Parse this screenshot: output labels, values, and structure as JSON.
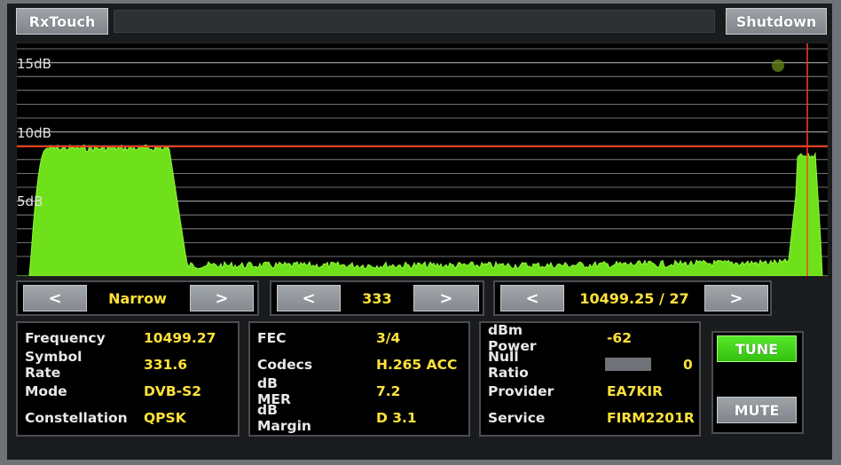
{
  "topbar": {
    "app_button": "RxTouch",
    "shutdown_button": "Shutdown"
  },
  "spectrum": {
    "y_labels": [
      "15dB",
      "10dB",
      "5dB"
    ],
    "colors": {
      "trace": "#6fe11b",
      "threshold": "#ff3b1e",
      "grid": "#c8c8c8"
    }
  },
  "controls": {
    "bandwidth": {
      "prev": "<",
      "value": "Narrow",
      "next": ">"
    },
    "symbol_rate": {
      "prev": "<",
      "value": "333",
      "next": ">"
    },
    "frequency": {
      "prev": "<",
      "value": "10499.25 / 27",
      "next": ">"
    }
  },
  "info": {
    "left": [
      {
        "label": "Frequency",
        "value": "10499.27"
      },
      {
        "label": "Symbol Rate",
        "value": "331.6"
      },
      {
        "label": "Mode",
        "value": "DVB-S2"
      },
      {
        "label": "Constellation",
        "value": "QPSK"
      }
    ],
    "middle": [
      {
        "label": "FEC",
        "value": "3/4"
      },
      {
        "label": "Codecs",
        "value": "H.265 ACC"
      },
      {
        "label": "dB MER",
        "value": "7.2"
      },
      {
        "label": "dB Margin",
        "value": "D 3.1"
      }
    ],
    "right": [
      {
        "label": "dBm Power",
        "value": "-62"
      },
      {
        "label": "Null Ratio",
        "value": "0"
      },
      {
        "label": "Provider",
        "value": "EA7KIR"
      },
      {
        "label": "Service",
        "value": "FIRM2201R"
      }
    ]
  },
  "buttons": {
    "tune": "TUNE",
    "mute": "MUTE",
    "tune_color": "#3fd11a"
  }
}
